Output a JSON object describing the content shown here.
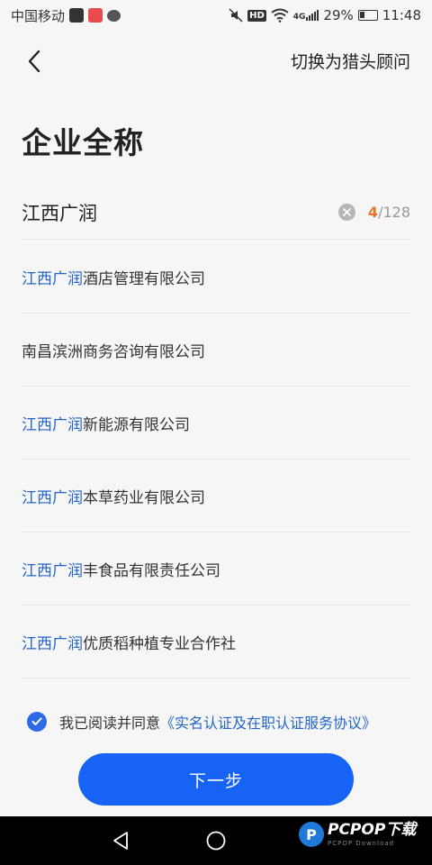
{
  "status_bar": {
    "carrier": "中国移动",
    "hd": "HD",
    "network": "4G",
    "battery": "29%",
    "time": "11:48"
  },
  "header": {
    "back_icon": "chevron-left-icon",
    "switch_label": "切换为猎头顾问"
  },
  "title": "企业全称",
  "input": {
    "value": "江西广润",
    "count_current": "4",
    "count_max": "/128",
    "clear_icon": "clear-circle-icon"
  },
  "suggestions": [
    {
      "match": "江西广润",
      "rest": "酒店管理有限公司"
    },
    {
      "match": "",
      "rest": "南昌滨洲商务咨询有限公司"
    },
    {
      "match": "江西广润",
      "rest": "新能源有限公司"
    },
    {
      "match": "江西广润",
      "rest": "本草药业有限公司"
    },
    {
      "match": "江西广润",
      "rest": "丰食品有限责任公司"
    },
    {
      "match": "江西广润",
      "rest": "优质稻种植专业合作社"
    }
  ],
  "agreement": {
    "checked": true,
    "text": "我已阅读并同意",
    "link": "《实名认证及在职认证服务协议》"
  },
  "next_button": "下一步",
  "watermark": {
    "brand": "PCPOP下载",
    "sub": "PCPOP Download"
  },
  "colors": {
    "primary": "#1663f5",
    "highlight": "#2366c8",
    "counter_accent": "#e8742b"
  }
}
